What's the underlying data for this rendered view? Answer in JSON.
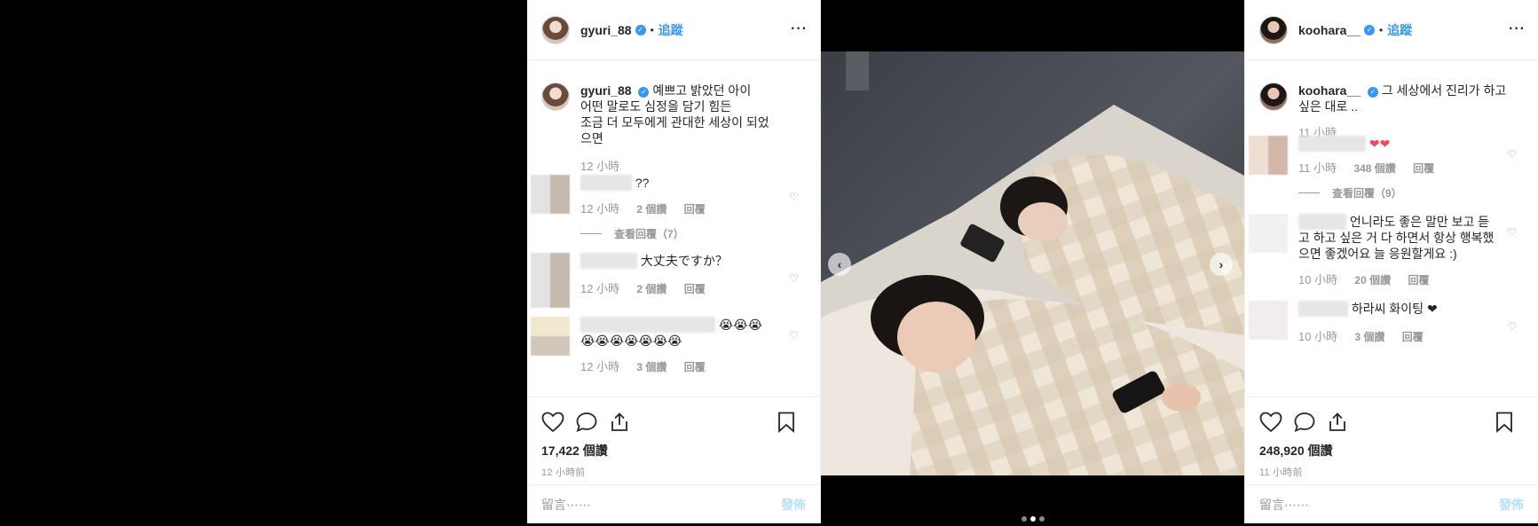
{
  "left_post": {
    "username": "gyuri_88",
    "follow_label": "追蹤",
    "caption_lines": [
      "예쁘고 밝았던 아이",
      "어떤 말로도 심정을 담기 힘든",
      "조금 더 모두에게 관대한 세상이 되었",
      "으면"
    ],
    "caption_time": "12 小時",
    "comments": [
      {
        "text": "??",
        "time": "12 小時",
        "likes": "2 個讚",
        "reply": "回覆",
        "view_replies": "查看回覆（7）"
      },
      {
        "text": "大丈夫ですか？",
        "time": "12 小時",
        "likes": "2 個讚",
        "reply": "回覆"
      },
      {
        "text": "😭😭😭",
        "text2": "😭😭😭😭😭😭😭",
        "time": "12 小時",
        "likes": "3 個讚",
        "reply": "回覆"
      }
    ],
    "like_count": "17,422 個讚",
    "posted_ago": "12 小時前",
    "comment_placeholder": "留言⋯⋯",
    "post_label": "發佈"
  },
  "right_post": {
    "username": "koohara__",
    "follow_label": "追蹤",
    "caption_lines": [
      "그 세상에서 진리가 하고",
      "싶은 대로 .."
    ],
    "caption_time": "11 小時",
    "comments": [
      {
        "text": "❤❤",
        "time": "11 小時",
        "likes": "348 個讚",
        "reply": "回覆",
        "view_replies": "查看回覆（9）"
      },
      {
        "text": "언니라도 좋은 말만 보고 듣고 하고 싶은 거 다 하면서 항상 행복했으면 좋겠어요 늘 응원할게요 :)",
        "time": "10 小時",
        "likes": "20 個讚",
        "reply": "回覆"
      },
      {
        "text": "하라씨 화이팅 ❤",
        "time": "10 小時",
        "likes": "3 個讚",
        "reply": "回覆"
      }
    ],
    "like_count": "248,920 個讚",
    "posted_ago": "11 小時前",
    "comment_placeholder": "留言⋯⋯",
    "post_label": "發佈"
  },
  "icons": {
    "like": "heart-icon",
    "comment": "comment-icon",
    "share": "share-icon",
    "save": "bookmark-icon",
    "more": "more-icon",
    "verified": "verified-badge-icon",
    "prev": "chevron-left-icon",
    "next": "chevron-right-icon"
  },
  "colors": {
    "link_blue": "#3897f0",
    "muted": "#999999",
    "heart_red": "#ed4956"
  },
  "carousel": {
    "slides": 3,
    "active_index": 1
  }
}
